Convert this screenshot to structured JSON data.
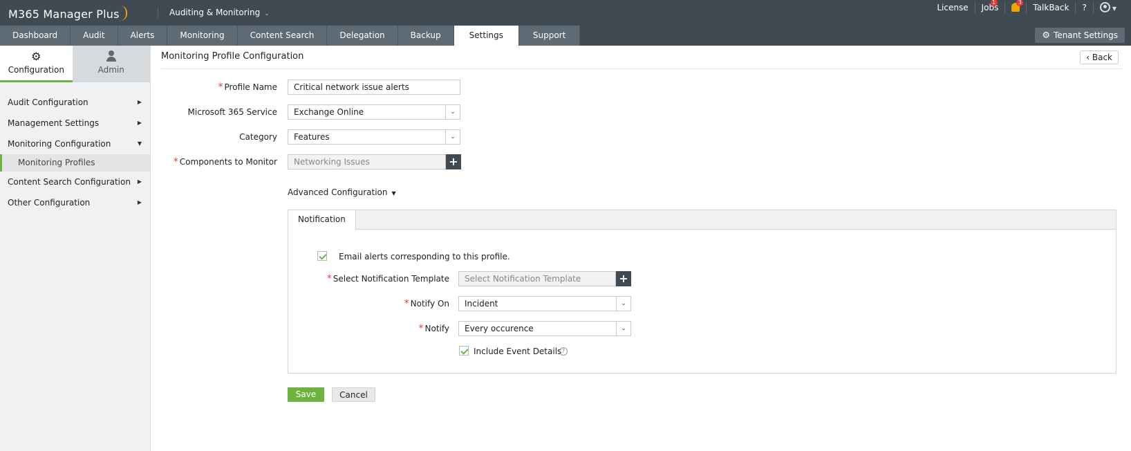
{
  "header": {
    "logo_text": "M365 Manager Plus",
    "module": "Auditing & Monitoring",
    "links": {
      "license": "License",
      "jobs": "Jobs",
      "jobs_badge": "1",
      "alerts_badge": "3",
      "talkback": "TalkBack",
      "help": "?"
    }
  },
  "nav": {
    "tabs": [
      "Dashboard",
      "Audit",
      "Alerts",
      "Monitoring",
      "Content Search",
      "Delegation",
      "Backup",
      "Settings",
      "Support"
    ],
    "active_tab": "Settings",
    "tenant_settings": "Tenant Settings"
  },
  "sidebar": {
    "tabs": {
      "configuration": "Configuration",
      "admin": "Admin"
    },
    "items": [
      {
        "label": "Audit Configuration"
      },
      {
        "label": "Management Settings"
      },
      {
        "label": "Monitoring Configuration"
      },
      {
        "label": "Monitoring Profiles"
      },
      {
        "label": "Content Search Configuration"
      },
      {
        "label": "Other Configuration"
      }
    ]
  },
  "main": {
    "title": "Monitoring Profile Configuration",
    "back": "Back",
    "form": {
      "profile_name_label": "Profile Name",
      "profile_name_value": "Critical network issue alerts",
      "service_label": "Microsoft 365 Service",
      "service_value": "Exchange Online",
      "category_label": "Category",
      "category_value": "Features",
      "components_label": "Components to Monitor",
      "components_placeholder": "Networking Issues",
      "advanced": "Advanced Configuration"
    },
    "notification": {
      "tab": "Notification",
      "email_alerts": "Email alerts corresponding to this profile.",
      "email_alerts_checked": true,
      "template_label": "Select Notification Template",
      "template_placeholder": "Select Notification Template",
      "notify_on_label": "Notify On",
      "notify_on_value": "Incident",
      "notify_label": "Notify",
      "notify_value": "Every occurence",
      "include_details": "Include Event Details",
      "include_details_checked": true
    },
    "buttons": {
      "save": "Save",
      "cancel": "Cancel"
    }
  },
  "colors": {
    "header_bg": "#3f4a53",
    "accent": "#6db33f",
    "required": "#e53935"
  }
}
